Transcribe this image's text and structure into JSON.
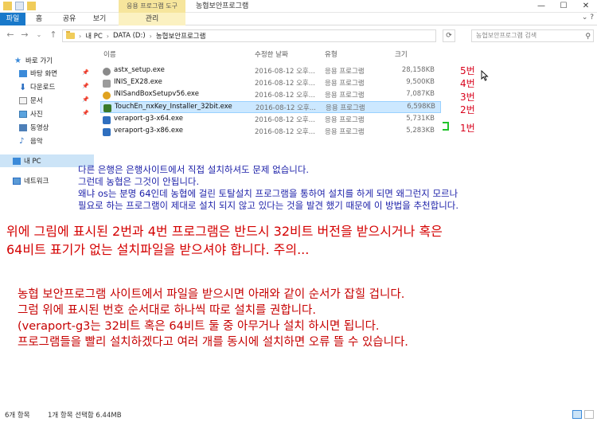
{
  "window": {
    "tool_tab_title": "응용 프로그램 도구",
    "title": "농협보안프로그램",
    "minimize": "—",
    "maximize": "☐",
    "close": "✕"
  },
  "ribbon": {
    "tabs": [
      "파일",
      "홈",
      "공유",
      "보기",
      "관리"
    ],
    "help": "⌄ ?"
  },
  "address": {
    "crumbs": [
      "내 PC",
      "DATA (D:)",
      "농협보안프로그램"
    ],
    "search_placeholder": "농협보안프로그램 검색"
  },
  "sidebar": {
    "items": [
      {
        "label": "바로 가기",
        "icon": "star-icon",
        "pinned": false
      },
      {
        "label": "바탕 화면",
        "icon": "desktop-icon",
        "pinned": true
      },
      {
        "label": "다운로드",
        "icon": "download-icon",
        "pinned": true
      },
      {
        "label": "문서",
        "icon": "document-icon",
        "pinned": true
      },
      {
        "label": "사진",
        "icon": "picture-icon",
        "pinned": true
      },
      {
        "label": "동영상",
        "icon": "video-icon",
        "pinned": false
      },
      {
        "label": "음악",
        "icon": "music-icon",
        "pinned": false
      },
      {
        "label": "내 PC",
        "icon": "pc-icon",
        "pinned": false
      },
      {
        "label": "네트워크",
        "icon": "network-icon",
        "pinned": false
      }
    ]
  },
  "columns": {
    "name": "이름",
    "date": "수정한 날짜",
    "type": "유형",
    "size": "크기"
  },
  "files": [
    {
      "name": "astx_setup.exe",
      "date": "2016-08-12 오후...",
      "type": "응용 프로그램",
      "size": "28,158KB",
      "color": "#8a8a8a",
      "order": "5번"
    },
    {
      "name": "INIS_EX28.exe",
      "date": "2016-08-12 오후...",
      "type": "응용 프로그램",
      "size": "9,500KB",
      "color": "#9b9b9b",
      "order": "4번"
    },
    {
      "name": "INISandBoxSetupv56.exe",
      "date": "2016-08-12 오후...",
      "type": "응용 프로그램",
      "size": "7,087KB",
      "color": "#e0a21f",
      "order": "3번"
    },
    {
      "name": "TouchEn_nxKey_Installer_32bit.exe",
      "date": "2016-08-12 오후...",
      "type": "응용 프로그램",
      "size": "6,598KB",
      "color": "#3a7a2a",
      "order": "2번"
    },
    {
      "name": "veraport-g3-x64.exe",
      "date": "2016-08-12 오후...",
      "type": "응용 프로그램",
      "size": "5,731KB",
      "color": "#2f6fbf",
      "order": ""
    },
    {
      "name": "veraport-g3-x86.exe",
      "date": "2016-08-12 오후...",
      "type": "응용 프로그램",
      "size": "5,283KB",
      "color": "#2f6fbf",
      "order": ""
    }
  ],
  "order_bracket_label": "1번",
  "notes": {
    "blue": [
      "다른 은행은 은행사이트에서 직접 설치하셔도 문제 없습니다.",
      "그런데 농협은 그것이 안됩니다.",
      "왜냐 os는 분명 64인데 농협에 걸린 토탈설치 프로그램을 통하여 설치를 하게 되면 왜그런지 모르나",
      "필요로 하는 프로그램이 제대로 설치 되지 않고 있다는 것을 발견 했기 때문에 이 방법을 추천합니다."
    ],
    "red": [
      "위에 그림에 표시된 2번과 4번 프로그램은 반드시 32비트 버전을 받으시거나 혹은",
      "64비트 표기가 없는 설치파일을 받으셔야 합니다. 주의..."
    ],
    "red2": [
      "농협 보안프로그램 사이트에서 파일을 받으시면 아래와 같이 순서가 잡힐 겁니다.",
      "그럼 위에 표시된 번호 순서대로 하나씩 따로 설치를 권합니다.",
      "(veraport-g3는 32비트 혹은 64비트 둘 중 아무거나 설치 하시면 됩니다.",
      "프로그램들을 빨리 설치하겠다고 여러 개를 동시에 설치하면 오류 뜰 수 있습니다."
    ]
  },
  "status": {
    "count": "6개 항목",
    "selection": "1개 항목 선택함 6.44MB"
  }
}
